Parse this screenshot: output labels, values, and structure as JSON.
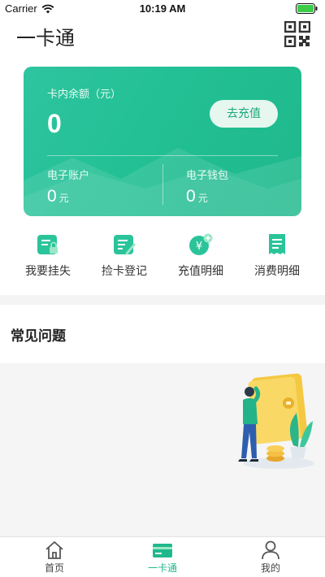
{
  "status_bar": {
    "carrier": "Carrier",
    "time": "10:19 AM"
  },
  "header": {
    "title": "一卡通"
  },
  "card": {
    "balance_label": "卡内余额（元）",
    "balance_value": "0",
    "recharge_label": "去充值",
    "electronic_account": {
      "label": "电子账户",
      "value": "0",
      "unit": "元"
    },
    "electronic_wallet": {
      "label": "电子钱包",
      "value": "0",
      "unit": "元"
    }
  },
  "actions": [
    {
      "label": "我要挂失",
      "icon": "report-loss-icon"
    },
    {
      "label": "捡卡登记",
      "icon": "found-card-icon"
    },
    {
      "label": "充值明细",
      "icon": "recharge-detail-icon"
    },
    {
      "label": "消费明细",
      "icon": "consumption-detail-icon"
    }
  ],
  "faq": {
    "title": "常见问题"
  },
  "tabs": [
    {
      "label": "首页",
      "icon": "home-icon",
      "active": false
    },
    {
      "label": "一卡通",
      "icon": "card-icon",
      "active": true
    },
    {
      "label": "我的",
      "icon": "profile-icon",
      "active": false
    }
  ],
  "colors": {
    "accent": "#1fb88c",
    "card_gradient_start": "#2ec4a0",
    "card_gradient_end": "#1fb88c",
    "band_bg": "#f5f5f5"
  }
}
